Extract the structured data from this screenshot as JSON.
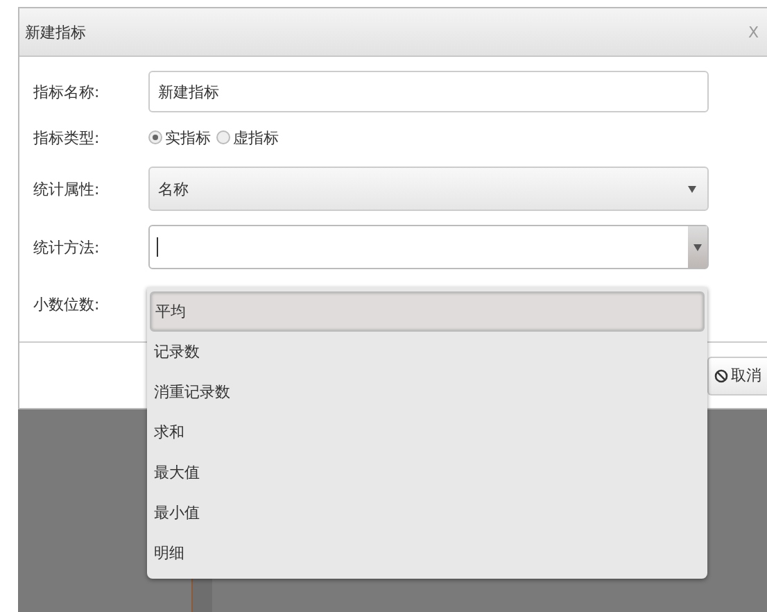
{
  "dialog": {
    "title": "新建指标",
    "close": "X"
  },
  "fields": [
    {
      "kind": "text",
      "label": "指标名称:",
      "value": "新建指标"
    },
    {
      "kind": "radio",
      "label": "指标类型:",
      "options": [
        {
          "label": "实指标",
          "selected": true
        },
        {
          "label": "虚指标",
          "selected": false
        }
      ]
    },
    {
      "kind": "select",
      "label": "统计属性:",
      "value": "名称"
    },
    {
      "kind": "combo",
      "label": "统计方法:",
      "expanded": true,
      "options": [
        {
          "label": "平均",
          "selected": true
        },
        {
          "label": "记录数",
          "selected": false
        },
        {
          "label": "消重记录数",
          "selected": false
        },
        {
          "label": "求和",
          "selected": false
        },
        {
          "label": "最大值",
          "selected": false
        },
        {
          "label": "最小值",
          "selected": false
        },
        {
          "label": "明细",
          "selected": false
        }
      ]
    },
    {
      "kind": "number",
      "label": "小数位数:"
    }
  ],
  "buttons": [
    {
      "label": "取消"
    }
  ]
}
